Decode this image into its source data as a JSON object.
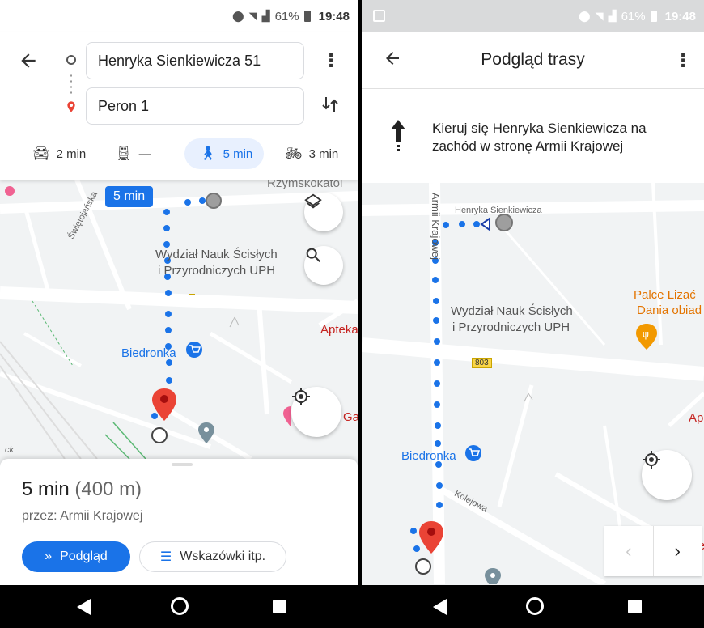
{
  "left": {
    "status": {
      "battery": "61%",
      "time": "19:48"
    },
    "origin": "Henryka Sienkiewicza 51",
    "destination": "Peron 1",
    "modes": [
      {
        "name": "car",
        "label": "2 min"
      },
      {
        "name": "transit",
        "label": "—"
      },
      {
        "name": "walk",
        "label": "5 min"
      },
      {
        "name": "bike",
        "label": "3 min"
      }
    ],
    "map": {
      "duration_tag": "5 min",
      "labels": {
        "street_top": "Rzymskokatol",
        "swietojanska": "Świętojańska",
        "faculty_line1": "Wydział Nauk Ścisłych",
        "faculty_line2": "i Przyrodniczych UPH",
        "road_number": "803",
        "apteka": "Apteka",
        "biedronka": "Biedronka",
        "ga": "Ga",
        "ck": "ck"
      }
    },
    "sheet": {
      "time": "5 min",
      "distance": "(400 m)",
      "via": "przez: Armii Krajowej",
      "preview_label": "Podgląd",
      "steps_label": "Wskazówki itp."
    }
  },
  "right": {
    "status": {
      "battery": "61%",
      "time": "19:48"
    },
    "title": "Podgląd trasy",
    "step_text": "Kieruj się Henryka Sienkiewicza na zachód w stronę Armii Krajowej",
    "map": {
      "labels": {
        "armii_krajowej": "Armii Krajowej",
        "henryka": "Henryka Sienkiewicza",
        "faculty_line1": "Wydział Nauk Ścisłych",
        "faculty_line2": "i Przyrodniczych UPH",
        "palce_line1": "Palce Lizać",
        "palce_line2": "Dania obiad",
        "road_number": "803",
        "biedronka": "Biedronka",
        "kolejowa": "Kolejowa",
        "ap": "Ap",
        "e": "e"
      }
    }
  },
  "colors": {
    "accent": "#1a73e8",
    "route": "#1a73e8",
    "pin": "#ea4335"
  }
}
